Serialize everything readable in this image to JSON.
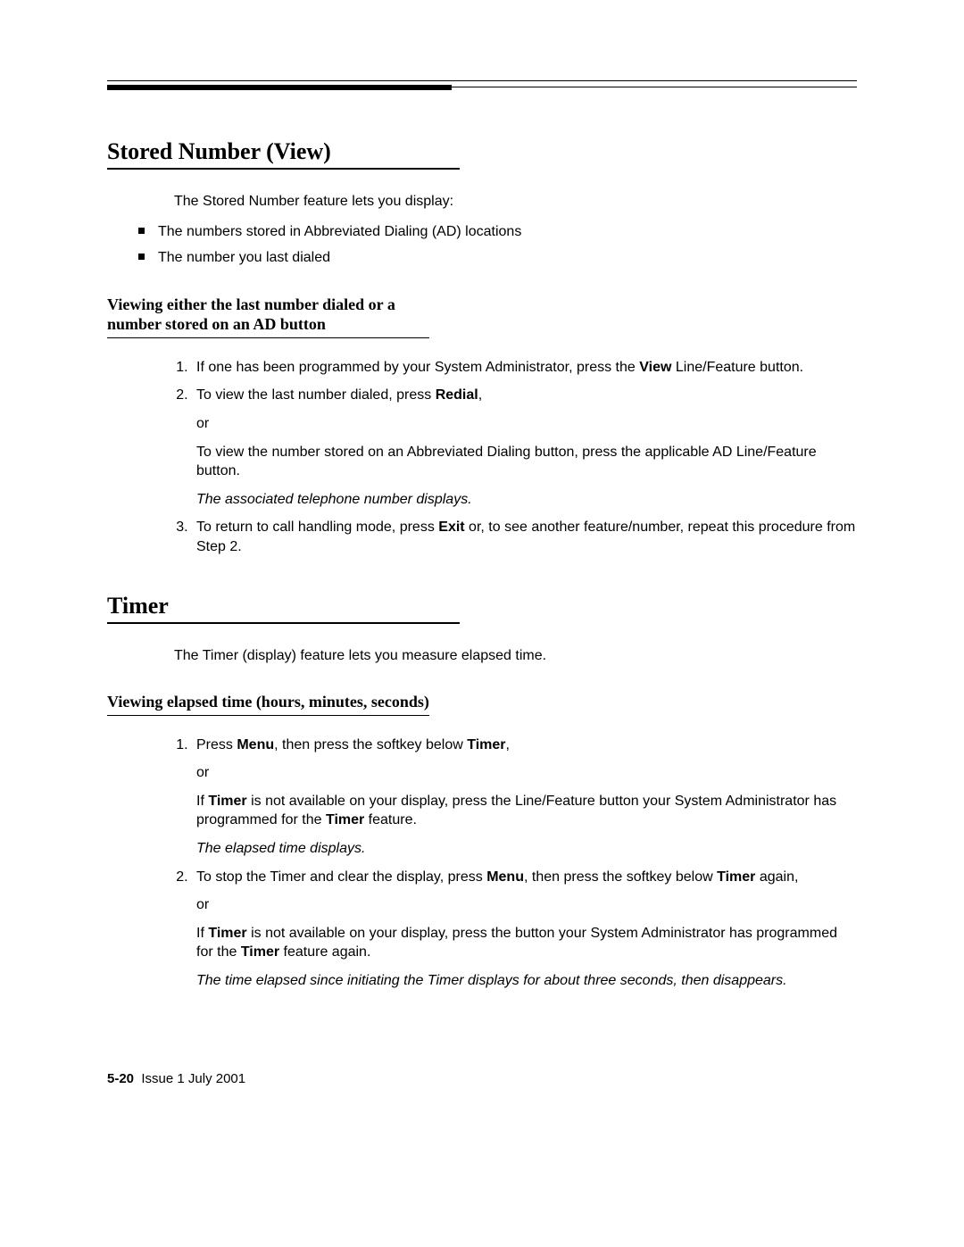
{
  "sections": {
    "storedNumber": {
      "title": "Stored Number (View)",
      "intro": "The Stored Number feature lets you display:",
      "bullets": [
        "The numbers stored in Abbreviated Dialing (AD) locations",
        "The number you last dialed"
      ],
      "sub": {
        "title": "Viewing either the last number dialed or a number stored on an AD button",
        "steps": {
          "s1a": "If one has been programmed by your System Administrator, press the ",
          "s1b": "View",
          "s1c": " Line/Feature button.",
          "s2a": "To view the last number dialed, press ",
          "s2b": "Redial",
          "s2c": ",",
          "s2or": "or",
          "s2d": "To view the number stored on an Abbreviated Dialing button, press the applicable AD Line/Feature button.",
          "s2e": "The associated telephone number displays.",
          "s3a": "To return to call handling mode, press ",
          "s3b": "Exit",
          "s3c": " or, to see another feature/number, repeat this procedure from Step 2."
        }
      }
    },
    "timer": {
      "title": "Timer",
      "intro": "The Timer (display) feature lets you measure elapsed time.",
      "sub": {
        "title": "Viewing elapsed time (hours, minutes, seconds)",
        "steps": {
          "s1a": "Press ",
          "s1b": "Menu",
          "s1c": ", then press the softkey below ",
          "s1d": "Timer",
          "s1e": ",",
          "s1or": "or",
          "s1f1": "If ",
          "s1f2": "Timer",
          "s1f3": " is not available on your display, press the Line/Feature button your System Administrator has programmed for the ",
          "s1f4": "Timer",
          "s1f5": " feature.",
          "s1g": "The elapsed time displays.",
          "s2a": "To stop the Timer and clear the display, press ",
          "s2b": "Menu",
          "s2c": ", then press the softkey below ",
          "s2d": "Timer",
          "s2e": " again,",
          "s2or": "or",
          "s2f1": "If ",
          "s2f2": "Timer",
          "s2f3": " is not available on your display, press the button your System Administrator has programmed for the ",
          "s2f4": "Timer",
          "s2f5": " feature again.",
          "s2g": "The time elapsed since initiating the Timer displays for about three seconds, then disappears."
        }
      }
    }
  },
  "footer": {
    "page": "5-20",
    "issue": "Issue  1   July 2001"
  }
}
